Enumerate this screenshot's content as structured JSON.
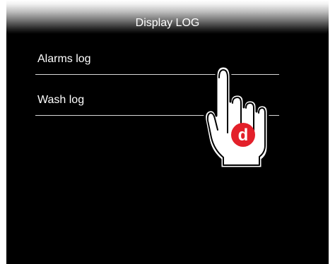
{
  "header": {
    "title": "Display LOG"
  },
  "menu": {
    "items": [
      {
        "label": "Alarms log"
      },
      {
        "label": "Wash log"
      }
    ]
  },
  "hand_cursor": {
    "badge_letter": "d",
    "badge_color": "#e3202a"
  }
}
